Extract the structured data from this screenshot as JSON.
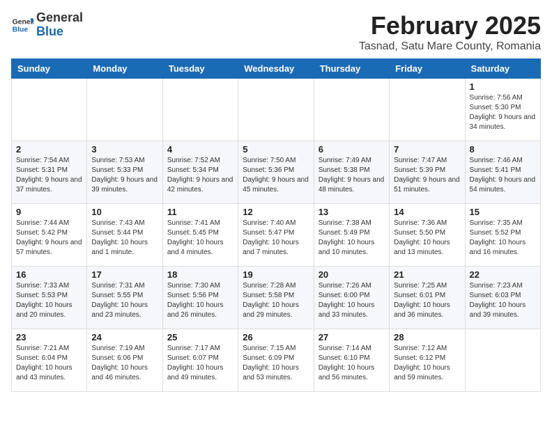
{
  "header": {
    "logo_general": "General",
    "logo_blue": "Blue",
    "title": "February 2025",
    "subtitle": "Tasnad, Satu Mare County, Romania"
  },
  "weekdays": [
    "Sunday",
    "Monday",
    "Tuesday",
    "Wednesday",
    "Thursday",
    "Friday",
    "Saturday"
  ],
  "weeks": [
    [
      {
        "day": "",
        "info": ""
      },
      {
        "day": "",
        "info": ""
      },
      {
        "day": "",
        "info": ""
      },
      {
        "day": "",
        "info": ""
      },
      {
        "day": "",
        "info": ""
      },
      {
        "day": "",
        "info": ""
      },
      {
        "day": "1",
        "info": "Sunrise: 7:56 AM\nSunset: 5:30 PM\nDaylight: 9 hours and 34 minutes."
      }
    ],
    [
      {
        "day": "2",
        "info": "Sunrise: 7:54 AM\nSunset: 5:31 PM\nDaylight: 9 hours and 37 minutes."
      },
      {
        "day": "3",
        "info": "Sunrise: 7:53 AM\nSunset: 5:33 PM\nDaylight: 9 hours and 39 minutes."
      },
      {
        "day": "4",
        "info": "Sunrise: 7:52 AM\nSunset: 5:34 PM\nDaylight: 9 hours and 42 minutes."
      },
      {
        "day": "5",
        "info": "Sunrise: 7:50 AM\nSunset: 5:36 PM\nDaylight: 9 hours and 45 minutes."
      },
      {
        "day": "6",
        "info": "Sunrise: 7:49 AM\nSunset: 5:38 PM\nDaylight: 9 hours and 48 minutes."
      },
      {
        "day": "7",
        "info": "Sunrise: 7:47 AM\nSunset: 5:39 PM\nDaylight: 9 hours and 51 minutes."
      },
      {
        "day": "8",
        "info": "Sunrise: 7:46 AM\nSunset: 5:41 PM\nDaylight: 9 hours and 54 minutes."
      }
    ],
    [
      {
        "day": "9",
        "info": "Sunrise: 7:44 AM\nSunset: 5:42 PM\nDaylight: 9 hours and 57 minutes."
      },
      {
        "day": "10",
        "info": "Sunrise: 7:43 AM\nSunset: 5:44 PM\nDaylight: 10 hours and 1 minute."
      },
      {
        "day": "11",
        "info": "Sunrise: 7:41 AM\nSunset: 5:45 PM\nDaylight: 10 hours and 4 minutes."
      },
      {
        "day": "12",
        "info": "Sunrise: 7:40 AM\nSunset: 5:47 PM\nDaylight: 10 hours and 7 minutes."
      },
      {
        "day": "13",
        "info": "Sunrise: 7:38 AM\nSunset: 5:49 PM\nDaylight: 10 hours and 10 minutes."
      },
      {
        "day": "14",
        "info": "Sunrise: 7:36 AM\nSunset: 5:50 PM\nDaylight: 10 hours and 13 minutes."
      },
      {
        "day": "15",
        "info": "Sunrise: 7:35 AM\nSunset: 5:52 PM\nDaylight: 10 hours and 16 minutes."
      }
    ],
    [
      {
        "day": "16",
        "info": "Sunrise: 7:33 AM\nSunset: 5:53 PM\nDaylight: 10 hours and 20 minutes."
      },
      {
        "day": "17",
        "info": "Sunrise: 7:31 AM\nSunset: 5:55 PM\nDaylight: 10 hours and 23 minutes."
      },
      {
        "day": "18",
        "info": "Sunrise: 7:30 AM\nSunset: 5:56 PM\nDaylight: 10 hours and 26 minutes."
      },
      {
        "day": "19",
        "info": "Sunrise: 7:28 AM\nSunset: 5:58 PM\nDaylight: 10 hours and 29 minutes."
      },
      {
        "day": "20",
        "info": "Sunrise: 7:26 AM\nSunset: 6:00 PM\nDaylight: 10 hours and 33 minutes."
      },
      {
        "day": "21",
        "info": "Sunrise: 7:25 AM\nSunset: 6:01 PM\nDaylight: 10 hours and 36 minutes."
      },
      {
        "day": "22",
        "info": "Sunrise: 7:23 AM\nSunset: 6:03 PM\nDaylight: 10 hours and 39 minutes."
      }
    ],
    [
      {
        "day": "23",
        "info": "Sunrise: 7:21 AM\nSunset: 6:04 PM\nDaylight: 10 hours and 43 minutes."
      },
      {
        "day": "24",
        "info": "Sunrise: 7:19 AM\nSunset: 6:06 PM\nDaylight: 10 hours and 46 minutes."
      },
      {
        "day": "25",
        "info": "Sunrise: 7:17 AM\nSunset: 6:07 PM\nDaylight: 10 hours and 49 minutes."
      },
      {
        "day": "26",
        "info": "Sunrise: 7:15 AM\nSunset: 6:09 PM\nDaylight: 10 hours and 53 minutes."
      },
      {
        "day": "27",
        "info": "Sunrise: 7:14 AM\nSunset: 6:10 PM\nDaylight: 10 hours and 56 minutes."
      },
      {
        "day": "28",
        "info": "Sunrise: 7:12 AM\nSunset: 6:12 PM\nDaylight: 10 hours and 59 minutes."
      },
      {
        "day": "",
        "info": ""
      }
    ]
  ]
}
